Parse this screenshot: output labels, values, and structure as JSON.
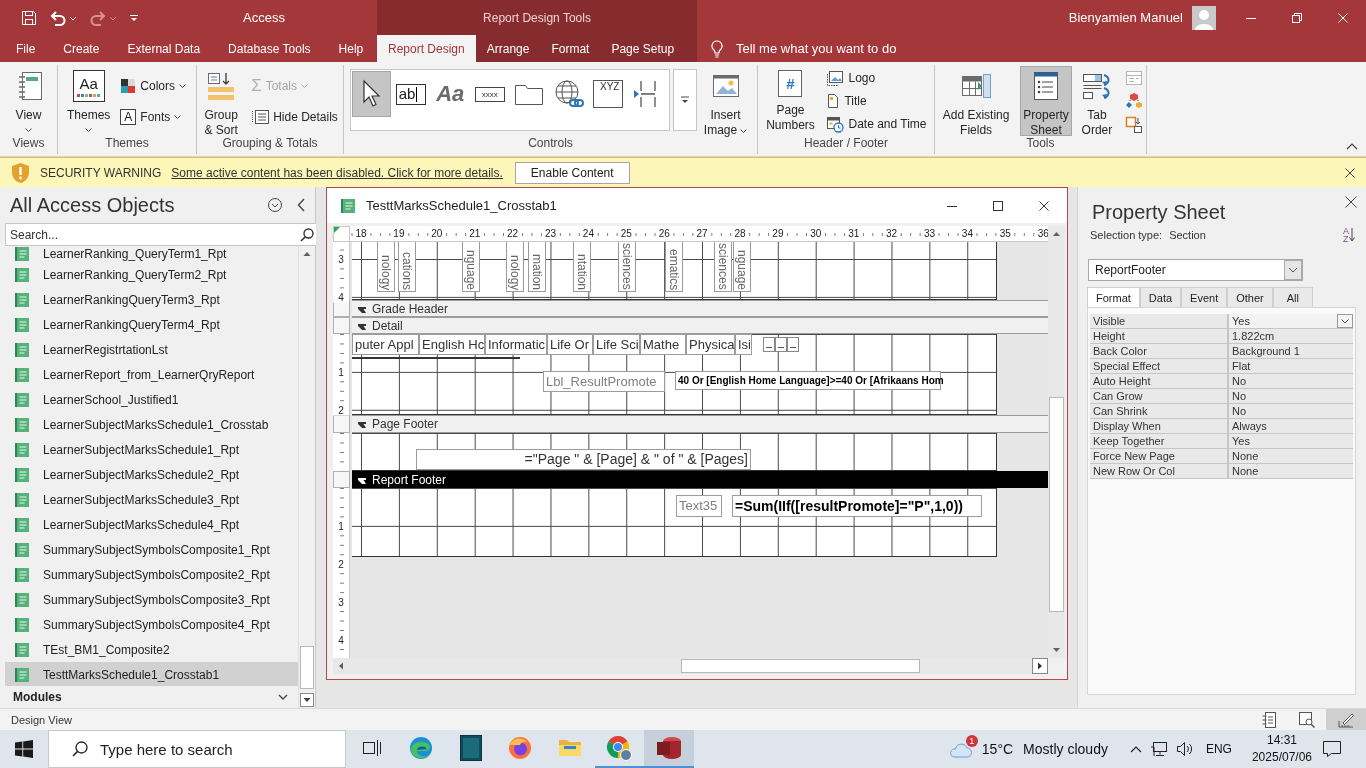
{
  "title_bar": {
    "quick_access": [
      {
        "kind": "save",
        "disabled": false
      },
      {
        "kind": "undo",
        "disabled": false
      },
      {
        "kind": "redo",
        "disabled": true
      },
      {
        "kind": "customize",
        "disabled": false
      }
    ],
    "app_title": "Access",
    "context_title": "Report Design Tools",
    "user_name": "Bienyamien Manuel"
  },
  "ribbon": {
    "tabs": [
      {
        "label": "File",
        "selected": false
      },
      {
        "label": "Create",
        "selected": false
      },
      {
        "label": "External Data",
        "selected": false
      },
      {
        "label": "Database Tools",
        "selected": false
      },
      {
        "label": "Help",
        "selected": false
      }
    ],
    "context_tabs": [
      {
        "label": "Report Design",
        "selected": true
      },
      {
        "label": "Arrange",
        "selected": false
      },
      {
        "label": "Format",
        "selected": false
      },
      {
        "label": "Page Setup",
        "selected": false
      }
    ],
    "tell_me": "Tell me what you want to do",
    "groups": [
      {
        "label": "Views",
        "columns": [
          {
            "items": [
              {
                "kind": "view",
                "label": "View",
                "dropdown": true,
                "disabled": false,
                "selected": false
              }
            ]
          }
        ]
      },
      {
        "label": "Themes",
        "columns": [
          {
            "items": [
              {
                "kind": "themes",
                "label": "Themes",
                "glyph": "Aa",
                "dropdown": true,
                "disabled": false,
                "selected": false
              }
            ]
          },
          {
            "items": [
              {
                "kind": "colors",
                "label": "Colors",
                "dropdown": true,
                "disabled": false,
                "selected": false
              },
              {
                "kind": "fonts",
                "label": "Fonts",
                "glyph": "A",
                "dropdown": true,
                "disabled": false,
                "selected": false
              }
            ]
          }
        ]
      },
      {
        "label": "Grouping & Totals",
        "columns": [
          {
            "items": [
              {
                "kind": "group-sort",
                "label": "Group & Sort",
                "dropdown": false,
                "disabled": false,
                "selected": false
              }
            ]
          },
          {
            "items": [
              {
                "kind": "totals",
                "label": "Totals",
                "glyph": "Σ",
                "dropdown": true,
                "disabled": true,
                "selected": false
              },
              {
                "kind": "hide-details",
                "label": "Hide Details",
                "dropdown": false,
                "disabled": false,
                "selected": false
              }
            ]
          }
        ]
      },
      {
        "label": "Controls",
        "columns": [
          {
            "items": [
              {
                "kind": "gallery",
                "tools": [
                  {
                    "kind": "pointer",
                    "selected": true
                  },
                  {
                    "kind": "text-box",
                    "glyph": "ab",
                    "selected": false
                  },
                  {
                    "kind": "label",
                    "glyph": "Aa",
                    "selected": false
                  },
                  {
                    "kind": "button",
                    "glyph": "xxxx",
                    "selected": false
                  },
                  {
                    "kind": "tab-control",
                    "selected": false
                  },
                  {
                    "kind": "hyperlink",
                    "selected": false
                  },
                  {
                    "kind": "option-group",
                    "glyph": "XYZ",
                    "selected": false
                  },
                  {
                    "kind": "page-break",
                    "selected": false
                  }
                ]
              }
            ]
          },
          {
            "items": [
              {
                "kind": "insert-image",
                "label": "Insert Image",
                "dropdown": true,
                "disabled": false,
                "selected": false
              }
            ]
          }
        ]
      },
      {
        "label": "Header / Footer",
        "columns": [
          {
            "items": [
              {
                "kind": "page-numbers",
                "label": "Page Numbers",
                "glyph": "#",
                "dropdown": false,
                "disabled": false,
                "selected": false
              }
            ]
          },
          {
            "items": [
              {
                "kind": "logo",
                "label": "Logo",
                "dropdown": false,
                "disabled": false,
                "selected": false
              },
              {
                "kind": "title",
                "label": "Title",
                "dropdown": false,
                "disabled": false,
                "selected": false
              },
              {
                "kind": "date-time",
                "label": "Date and Time",
                "dropdown": false,
                "disabled": false,
                "selected": false
              }
            ]
          }
        ]
      },
      {
        "label": "Tools",
        "columns": [
          {
            "items": [
              {
                "kind": "add-fields",
                "label": "Add Existing Fields",
                "dropdown": false,
                "disabled": false,
                "selected": false
              }
            ]
          },
          {
            "items": [
              {
                "kind": "property-sheet",
                "label": "Property Sheet",
                "dropdown": false,
                "disabled": false,
                "selected": true
              }
            ]
          },
          {
            "items": [
              {
                "kind": "tab-order",
                "label": "Tab Order",
                "dropdown": false,
                "disabled": false,
                "selected": false
              }
            ]
          },
          {
            "items": [
              {
                "kind": "subreport",
                "disabled": true,
                "selected": false
              },
              {
                "kind": "shapes",
                "disabled": false,
                "selected": false
              },
              {
                "kind": "convert",
                "disabled": false,
                "selected": false
              }
            ]
          }
        ]
      }
    ]
  },
  "security_bar": {
    "title": "SECURITY WARNING",
    "message": "Some active content has been disabled. Click for more details.",
    "button": "Enable Content"
  },
  "navigation": {
    "title": "All Access Objects",
    "search": {
      "placeholder": "Search..."
    },
    "items": [
      {
        "label": "LearnerRanking_QueryTerm1_Rpt",
        "selected": false
      },
      {
        "label": "LearnerRanking_QueryTerm2_Rpt",
        "selected": false
      },
      {
        "label": "LearnerRankingQueryTerm3_Rpt",
        "selected": false
      },
      {
        "label": "LearnerRankingQueryTerm4_Rpt",
        "selected": false
      },
      {
        "label": "LearnerRegistrtationLst",
        "selected": false
      },
      {
        "label": "LearnerReport_from_LearnerQryReport",
        "selected": false
      },
      {
        "label": "LearnerSchool_Justified1",
        "selected": false
      },
      {
        "label": "LearnerSubjectMarksSchedule1_Crosstab",
        "selected": false
      },
      {
        "label": "LearnerSubjectMarksSchedule1_Rpt",
        "selected": false
      },
      {
        "label": "LearnerSubjectMarksSchedule2_Rpt",
        "selected": false
      },
      {
        "label": "LearnerSubjectMarksSchedule3_Rpt",
        "selected": false
      },
      {
        "label": "LearnerSubjectMarksSchedule4_Rpt",
        "selected": false
      },
      {
        "label": "SummarySubjectSymbolsComposite1_Rpt",
        "selected": false
      },
      {
        "label": "SummarySubjectSymbolsComposite2_Rpt",
        "selected": false
      },
      {
        "label": "SummarySubjectSymbolsComposite3_Rpt",
        "selected": false
      },
      {
        "label": "SummarySubjectSymbolsComposite4_Rpt",
        "selected": false
      },
      {
        "label": "TEst_BM1_Composite2",
        "selected": false
      },
      {
        "label": "TesttMarksSchedule1_Crosstab1",
        "selected": true
      }
    ],
    "groups": [
      {
        "label": "Modules",
        "expanded": false
      }
    ]
  },
  "report_window": {
    "title": "TesttMarksSchedule1_Crosstab1",
    "ruler": [
      "18",
      "19",
      "20",
      "21",
      "22",
      "23",
      "24",
      "25",
      "26",
      "27",
      "28",
      "29",
      "30",
      "31",
      "32",
      "33",
      "34",
      "35",
      "36"
    ],
    "sections": [
      {
        "kind": "body",
        "ruler": [
          "3",
          "4"
        ],
        "controls": [
          {
            "kind": "column-label",
            "text": "nology"
          },
          {
            "kind": "column-label",
            "text": "cations"
          },
          {
            "kind": "column-label",
            "text": "nguage"
          },
          {
            "kind": "column-label",
            "text": "nology"
          },
          {
            "kind": "column-label",
            "text": "mation"
          },
          {
            "kind": "column-label",
            "text": "ntation"
          },
          {
            "kind": "column-label",
            "text": "sciences"
          },
          {
            "kind": "column-label",
            "text": "ematics"
          },
          {
            "kind": "column-label",
            "text": "sciences"
          },
          {
            "kind": "column-label",
            "text": "nguage"
          }
        ]
      },
      {
        "kind": "band",
        "label": "Grade Header",
        "selected": false
      },
      {
        "kind": "band",
        "label": "Detail",
        "selected": false
      },
      {
        "kind": "body",
        "ruler": [
          "1",
          "2"
        ],
        "controls": [
          {
            "kind": "field",
            "text": "puter Appl"
          },
          {
            "kind": "field",
            "text": "English Hc"
          },
          {
            "kind": "field",
            "text": "Informatic"
          },
          {
            "kind": "field",
            "text": "Life Or"
          },
          {
            "kind": "field",
            "text": "Life Sci"
          },
          {
            "kind": "field",
            "text": "Mathe"
          },
          {
            "kind": "field",
            "text": "Physica"
          },
          {
            "kind": "field",
            "text": "Isi"
          },
          {
            "kind": "tiny-box"
          },
          {
            "kind": "tiny-box"
          },
          {
            "kind": "tiny-box"
          },
          {
            "kind": "line"
          },
          {
            "kind": "caption",
            "text": "Lbl_ResultPromote"
          },
          {
            "kind": "formula",
            "text": "40 Or [English Home Language]>=40 Or [Afrikaans Hom"
          }
        ]
      },
      {
        "kind": "band",
        "label": "Page Footer",
        "selected": false
      },
      {
        "kind": "body",
        "controls": [
          {
            "kind": "page-number",
            "text": "=\"Page \" & [Page] & \" of \" & [Pages]"
          }
        ]
      },
      {
        "kind": "band",
        "label": "Report Footer",
        "selected": true
      },
      {
        "kind": "body",
        "ruler": [
          "1",
          "2",
          "3",
          "4"
        ],
        "controls": [
          {
            "kind": "caption",
            "text": "Text35"
          },
          {
            "kind": "formula",
            "text": "=Sum(IIf([resultPromote]=\"P\",1,0))"
          }
        ]
      }
    ]
  },
  "property_sheet": {
    "title": "Property Sheet",
    "selection_label": "Selection type:",
    "selection_value": "Section",
    "sort_glyph": "AZ",
    "object": "ReportFooter",
    "tabs": [
      {
        "label": "Format",
        "selected": true
      },
      {
        "label": "Data",
        "selected": false
      },
      {
        "label": "Event",
        "selected": false
      },
      {
        "label": "Other",
        "selected": false
      },
      {
        "label": "All",
        "selected": false
      }
    ],
    "properties": [
      {
        "name": "Visible",
        "value": "Yes",
        "selected": true
      },
      {
        "name": "Height",
        "value": "1.822cm",
        "selected": false
      },
      {
        "name": "Back Color",
        "value": "Background 1",
        "selected": false
      },
      {
        "name": "Special Effect",
        "value": "Flat",
        "selected": false
      },
      {
        "name": "Auto Height",
        "value": "No",
        "selected": false
      },
      {
        "name": "Can Grow",
        "value": "No",
        "selected": false
      },
      {
        "name": "Can Shrink",
        "value": "No",
        "selected": false
      },
      {
        "name": "Display When",
        "value": "Always",
        "selected": false
      },
      {
        "name": "Keep Together",
        "value": "Yes",
        "selected": false
      },
      {
        "name": "Force New Page",
        "value": "None",
        "selected": false
      },
      {
        "name": "New Row Or Col",
        "value": "None",
        "selected": false
      }
    ]
  },
  "status_bar": {
    "text": "Design View",
    "views": [
      {
        "kind": "report-view",
        "selected": false
      },
      {
        "kind": "print-preview",
        "selected": false
      },
      {
        "kind": "design-view",
        "selected": true
      }
    ]
  },
  "taskbar": {
    "search": {
      "placeholder": "Type here to search"
    },
    "apps": [
      {
        "kind": "task-view",
        "running": false,
        "selected": false
      },
      {
        "kind": "edge",
        "running": false,
        "selected": false
      },
      {
        "kind": "book",
        "running": false,
        "selected": false
      },
      {
        "kind": "firefox",
        "running": false,
        "selected": false
      },
      {
        "kind": "explorer",
        "running": false,
        "selected": false
      },
      {
        "kind": "chrome",
        "running": true,
        "selected": false
      },
      {
        "kind": "access",
        "running": true,
        "selected": true
      }
    ],
    "weather": {
      "temperature": "15°C",
      "condition": "Mostly cloudy",
      "badge": "1"
    },
    "language": "ENG",
    "time": "14:31",
    "date": "2025/07/06"
  }
}
